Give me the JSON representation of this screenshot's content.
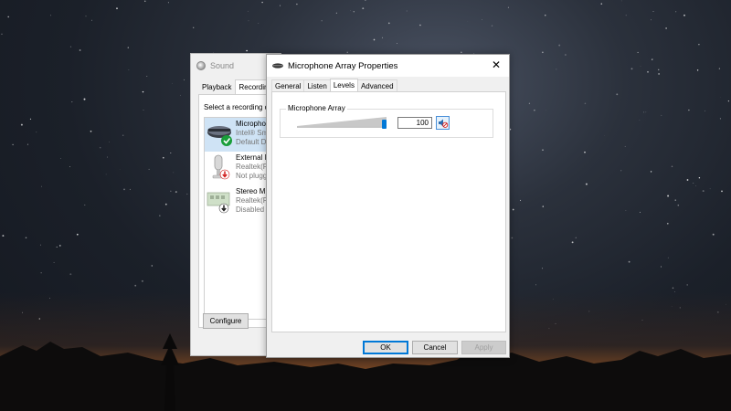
{
  "sound_window": {
    "title": "Sound",
    "tabs": [
      "Playback",
      "Recording"
    ],
    "active_tab": 1,
    "prompt": "Select a recording de",
    "devices": [
      {
        "name": "Micropho",
        "sub1": "Intel® Sm",
        "sub2": "Default De",
        "status": "default",
        "icon": "microphone-array-icon"
      },
      {
        "name": "External M",
        "sub1": "Realtek(R)",
        "sub2": "Not plugg",
        "status": "unplugged",
        "icon": "external-microphone-icon"
      },
      {
        "name": "Stereo Mi",
        "sub1": "Realtek(R)",
        "sub2": "Disabled",
        "status": "disabled",
        "icon": "stereo-mix-icon"
      }
    ],
    "configure_label": "Configure"
  },
  "properties_dialog": {
    "title": "Microphone Array Properties",
    "tabs": [
      "General",
      "Listen",
      "Levels",
      "Advanced"
    ],
    "active_tab": 2,
    "levels": {
      "group_label": "Microphone Array",
      "level_value": "100",
      "slider_level": 1.0
    },
    "buttons": {
      "ok": "OK",
      "cancel": "Cancel",
      "apply": "Apply"
    }
  },
  "colors": {
    "accent": "#0078d7",
    "default_check": "#1a9e3a",
    "unplugged_arrow": "#d21f1f"
  }
}
